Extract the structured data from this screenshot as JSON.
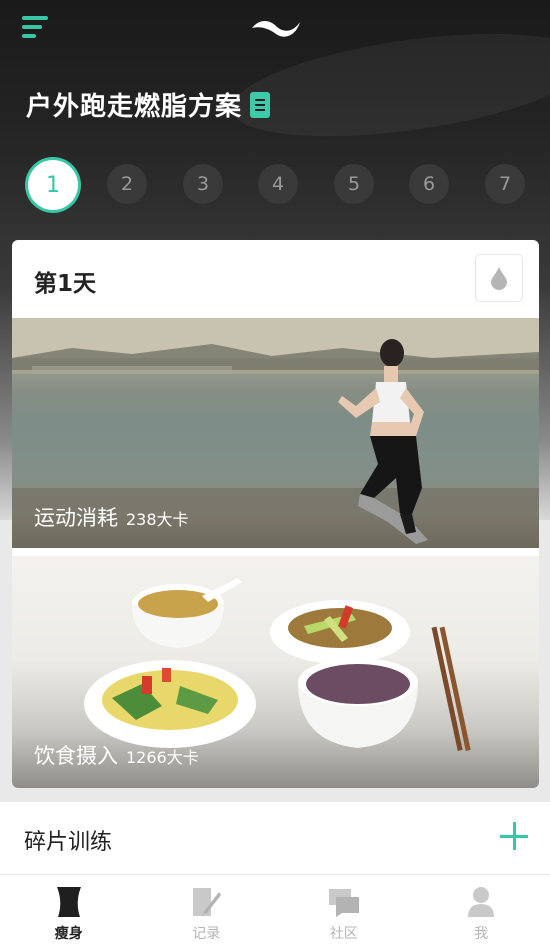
{
  "header": {
    "menu_icon": "hamburger-menu-icon",
    "logo_icon": "wave-logo-icon",
    "plan_title": "户外跑走燃脂方案",
    "plan_doc_icon": "document-icon",
    "accent_color": "#37c7a7"
  },
  "days": {
    "items": [
      "1",
      "2",
      "3",
      "4",
      "5",
      "6",
      "7"
    ],
    "selected": "1"
  },
  "day_card": {
    "title": "第1天",
    "water_icon": "water-drop-icon",
    "exercise": {
      "label": "运动消耗",
      "calories": "238大卡"
    },
    "diet": {
      "label": "饮食摄入",
      "calories": "1266大卡"
    }
  },
  "fragments": {
    "title": "碎片训练",
    "add_icon": "plus-icon"
  },
  "tabbar": {
    "items": [
      {
        "label": "瘦身",
        "icon": "body-shape-icon",
        "active": true
      },
      {
        "label": "记录",
        "icon": "notebook-icon",
        "active": false
      },
      {
        "label": "社区",
        "icon": "chat-bubbles-icon",
        "active": false
      },
      {
        "label": "我",
        "icon": "user-icon",
        "active": false
      }
    ]
  }
}
